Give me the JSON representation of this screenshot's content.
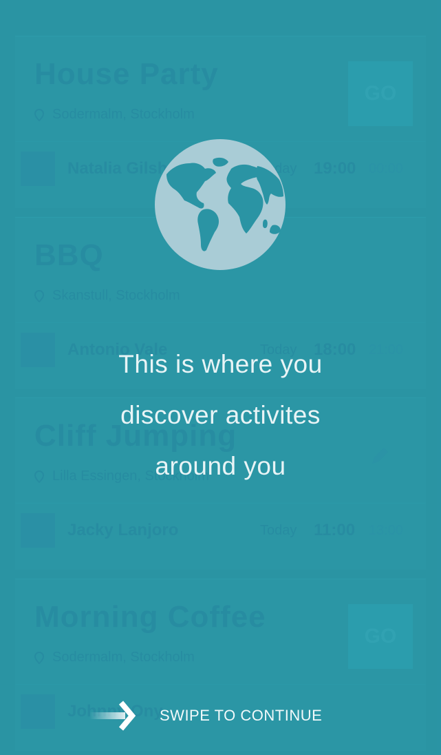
{
  "feed": {
    "cards": [
      {
        "title": "House Party",
        "location": "Sodermalm, Stockholm",
        "action": "GO",
        "host": "Natalia Gilsh",
        "day": "Today",
        "time": "19:00",
        "end": "00:00"
      },
      {
        "title": "BBQ",
        "location": "Skanstull, Stockholm",
        "action": "",
        "host": "Antonio Vale",
        "day": "Today",
        "time": "18:00",
        "end": "21:00"
      },
      {
        "title": "Cliff Jumping",
        "location": "Lilla Essingen, Stockholm",
        "action": "edit",
        "host": "Jacky Lanjoro",
        "day": "Today",
        "time": "11:00",
        "end": "13:00"
      },
      {
        "title": "Morning Coffee",
        "location": "Sodermalm, Stockholm",
        "action": "GO",
        "host": "Johnny Ony",
        "day": "",
        "time": "",
        "end": ""
      }
    ]
  },
  "onboarding": {
    "icon": "globe-icon",
    "line1": "This is where you",
    "line2": "discover activites",
    "line3": "around you",
    "swipe_label": "SWIPE TO CONTINUE",
    "swipe_icon": "chevron-right-icon"
  },
  "colors": {
    "background": "#2a94a4",
    "globe": "#a9ccd6",
    "text": "#e8f4f6"
  }
}
